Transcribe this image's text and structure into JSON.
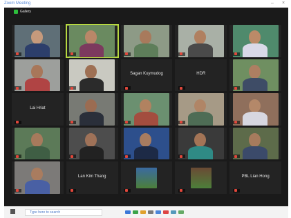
{
  "window": {
    "title": "Zoom Meeting",
    "minimize": "–",
    "close": "×"
  },
  "meeting": {
    "view_label": "Gallery"
  },
  "participants": [
    {
      "name": "",
      "label": "",
      "muted": true,
      "bg": "#5f6f77",
      "skin": "#c69a7c",
      "shirt": "#2c3e6b",
      "active": false
    },
    {
      "name": "",
      "label": "",
      "muted": true,
      "bg": "#6a8a60",
      "skin": "#b98768",
      "shirt": "#7c3a5e",
      "active": true
    },
    {
      "name": "",
      "label": "",
      "muted": true,
      "bg": "#8d9a86",
      "skin": "#a87a5c",
      "shirt": "#5e7e5a",
      "active": false
    },
    {
      "name": "",
      "label": "",
      "muted": true,
      "bg": "#a9b0a6",
      "skin": "#b08060",
      "shirt": "#4a4a4a",
      "active": false
    },
    {
      "name": "",
      "label": "",
      "muted": true,
      "bg": "#4f8a6c",
      "skin": "#bb8a68",
      "shirt": "#d9d9e8",
      "active": false
    },
    {
      "name": "",
      "label": "",
      "muted": true,
      "bg": "#9d9f9c",
      "skin": "#a8775a",
      "shirt": "#b04444",
      "active": false
    },
    {
      "name": "",
      "label": "",
      "muted": true,
      "bg": "#c9c9c1",
      "skin": "#9e7054",
      "shirt": "#2b2b2b",
      "active": false
    },
    {
      "name": "Sagan Kuymudog",
      "label": "",
      "muted": true,
      "bg": "",
      "skin": "",
      "shirt": "",
      "active": false
    },
    {
      "name": "HDR",
      "label": "",
      "muted": true,
      "bg": "",
      "skin": "",
      "shirt": "",
      "active": false
    },
    {
      "name": "",
      "label": "",
      "muted": true,
      "bg": "#6f8f61",
      "skin": "#ad7f62",
      "shirt": "#3e4c66",
      "active": false
    },
    {
      "name": "Lai Hriat",
      "label": "",
      "muted": true,
      "bg": "",
      "skin": "",
      "shirt": "",
      "active": false
    },
    {
      "name": "",
      "label": "",
      "muted": true,
      "bg": "#787a74",
      "skin": "#9b6c52",
      "shirt": "#2a2f3a",
      "active": false
    },
    {
      "name": "",
      "label": "",
      "muted": true,
      "bg": "#6b9070",
      "skin": "#b18260",
      "shirt": "#a34d3f",
      "active": false
    },
    {
      "name": "",
      "label": "",
      "muted": true,
      "bg": "#a69a86",
      "skin": "#b08566",
      "shirt": "#4e6c55",
      "active": false
    },
    {
      "name": "",
      "label": "",
      "muted": true,
      "bg": "#8f6f5c",
      "skin": "#b48869",
      "shirt": "#d7d7e0",
      "active": false
    },
    {
      "name": "",
      "label": "",
      "muted": true,
      "bg": "#5c7a58",
      "skin": "#a77a5c",
      "shirt": "#3f5e44",
      "active": false
    },
    {
      "name": "",
      "label": "",
      "muted": true,
      "bg": "#4d4d4d",
      "skin": "#9f7258",
      "shirt": "#222222",
      "active": false
    },
    {
      "name": "",
      "label": "",
      "muted": true,
      "bg": "#2d4f8c",
      "skin": "#a87c60",
      "shirt": "#1d2a46",
      "active": false
    },
    {
      "name": "",
      "label": "",
      "muted": true,
      "bg": "#3a3a3a",
      "skin": "#a37456",
      "shirt": "#2f8a85",
      "active": false
    },
    {
      "name": "",
      "label": "",
      "muted": true,
      "bg": "#5d6b4a",
      "skin": "#a77b5d",
      "shirt": "#3b4a6a",
      "active": false
    },
    {
      "name": "",
      "label": "",
      "muted": true,
      "bg": "#7c7a78",
      "skin": "#a97c5f",
      "shirt": "#4960a4",
      "active": false
    },
    {
      "name": "Lan Kim Thang",
      "label": "",
      "muted": true,
      "bg": "",
      "skin": "",
      "shirt": "",
      "active": false
    },
    {
      "name": "",
      "label": "",
      "muted": true,
      "bg": "#3a6aa0",
      "skin": "",
      "shirt": "",
      "active": false,
      "landscape": true
    },
    {
      "name": "",
      "label": "",
      "muted": true,
      "bg": "#6b4a34",
      "skin": "",
      "shirt": "",
      "active": false,
      "landscape": true
    },
    {
      "name": "PBL Lian Hong",
      "label": "",
      "muted": true,
      "bg": "",
      "skin": "",
      "shirt": "",
      "active": false
    }
  ],
  "taskbar": {
    "search_placeholder": "Type here to search",
    "time": "",
    "date": "",
    "tray_colors": [
      "#3b78d8",
      "#3aa34a",
      "#e0a12d",
      "#7a7a7a",
      "#4c86d9",
      "#d44",
      "#59b",
      "#6a6"
    ]
  }
}
